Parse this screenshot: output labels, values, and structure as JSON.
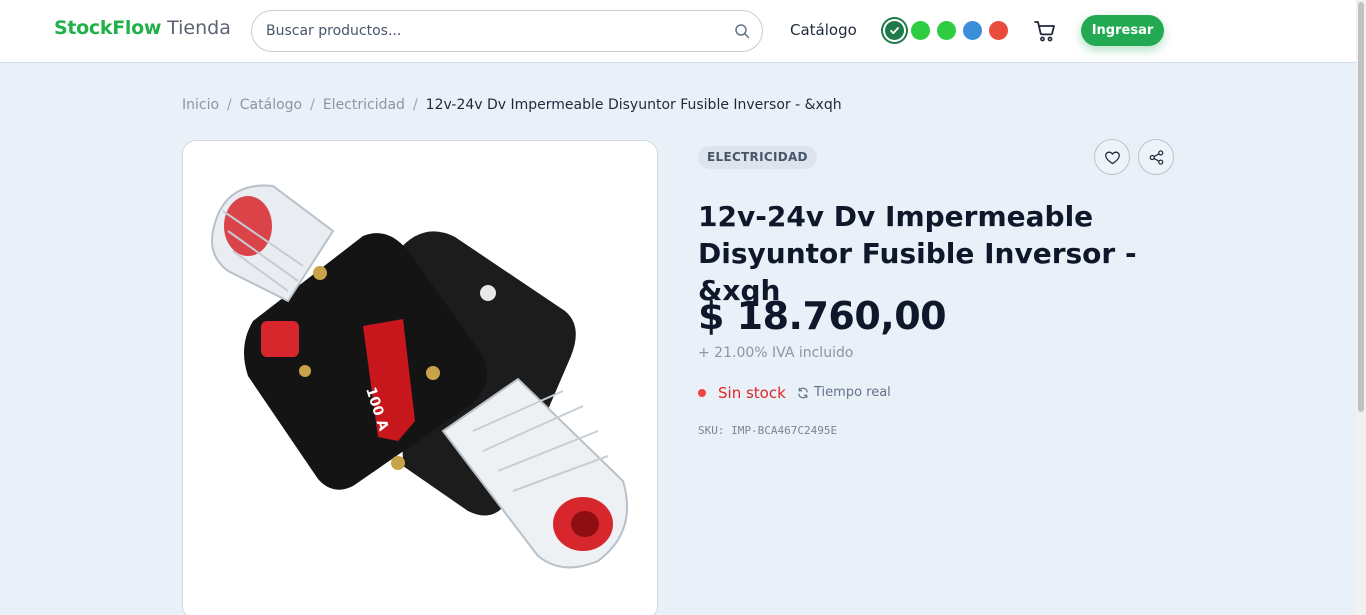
{
  "header": {
    "brand": "StockFlow",
    "brand_suffix": "Tienda",
    "search_placeholder": "Buscar productos...",
    "nav_catalog": "Catálogo",
    "theme_swatches": [
      "#1f7a4a",
      "#2ecc40",
      "#2ecc40",
      "#3b8fd9",
      "#e74c3c"
    ],
    "selected_swatch": 0,
    "login_label": "Ingresar"
  },
  "breadcrumb": {
    "items": [
      "Inicio",
      "Catálogo",
      "Electricidad"
    ],
    "separator": "/",
    "current": "12v-24v Dv Impermeable Disyuntor Fusible Inversor - &xqh"
  },
  "product": {
    "category": "ELECTRICIDAD",
    "title": "12v-24v Dv Impermeable Disyuntor Fusible Inversor - &xqh",
    "price": "$ 18.760,00",
    "tax_note": "+ 21.00% IVA incluido",
    "stock_status": "Sin stock",
    "realtime_label": "Tiempo real",
    "sku": "SKU: IMP-BCA467C2495E",
    "image_label": "100 A"
  },
  "colors": {
    "brand": "#22b04b",
    "accent_button": "#22a952",
    "out_of_stock": "#dc2626"
  }
}
